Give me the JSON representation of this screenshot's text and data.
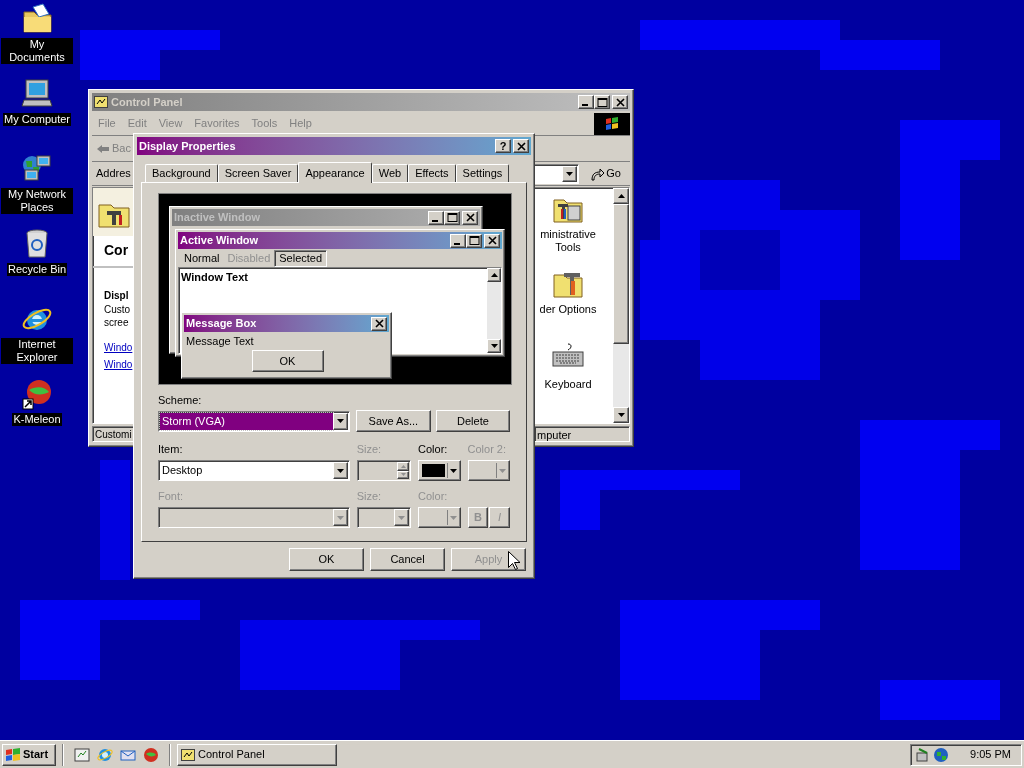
{
  "desktop_icons": [
    {
      "label": "My Documents",
      "kind": "documents"
    },
    {
      "label": "My Computer",
      "kind": "computer"
    },
    {
      "label": "My Network Places",
      "kind": "network"
    },
    {
      "label": "Recycle Bin",
      "kind": "recycle"
    },
    {
      "label": "Internet Explorer",
      "kind": "browser"
    },
    {
      "label": "K-Meleon",
      "kind": "kmeleon"
    }
  ],
  "control_panel": {
    "title": "Control Panel",
    "menu": [
      "File",
      "Edit",
      "View",
      "Favorites",
      "Tools",
      "Help"
    ],
    "back_button": "Bac",
    "address_label": "Addres",
    "go_button": "Go",
    "left_pane": {
      "heading": "Cor",
      "subheading": "Displ",
      "description": [
        "Custo",
        "scree"
      ],
      "links": [
        "Windo",
        "Windo"
      ]
    },
    "items": [
      {
        "label": "ministrative Tools",
        "kind": "admin"
      },
      {
        "label": "der Options",
        "kind": "folder_options"
      },
      {
        "label": "Keyboard",
        "kind": "keyboard"
      }
    ],
    "status": [
      "Customi",
      "mputer"
    ]
  },
  "dialog": {
    "title": "Display Properties",
    "help_button": "?",
    "tabs": [
      {
        "label": "Background",
        "selected": false
      },
      {
        "label": "Screen Saver",
        "selected": false
      },
      {
        "label": "Appearance",
        "selected": true
      },
      {
        "label": "Web",
        "selected": false
      },
      {
        "label": "Effects",
        "selected": false
      },
      {
        "label": "Settings",
        "selected": false
      }
    ],
    "preview": {
      "inactive_title": "Inactive Window",
      "active_title": "Active Window",
      "menu": [
        {
          "label": "Normal",
          "kind": "normal"
        },
        {
          "label": "Disabled",
          "kind": "disabled"
        },
        {
          "label": "Selected",
          "kind": "selected"
        }
      ],
      "window_text": "Window Text",
      "message_box": {
        "title": "Message Box",
        "text": "Message Text",
        "button": "OK"
      }
    },
    "scheme": {
      "label": "Scheme:",
      "value": "Storm (VGA)"
    },
    "scheme_buttons": [
      "Save As...",
      "Delete"
    ],
    "item_fields": [
      {
        "label": "Item:",
        "kind": "combo",
        "value": "Desktop",
        "disabled": false
      },
      {
        "label": "Size:",
        "kind": "spinner",
        "disabled": true
      },
      {
        "label": "Color:",
        "kind": "color",
        "color": "#000000",
        "disabled": false
      },
      {
        "label": "Color 2:",
        "kind": "color",
        "disabled": true
      }
    ],
    "font_fields": [
      {
        "label": "Font:",
        "kind": "combo",
        "disabled": true
      },
      {
        "label": "Size:",
        "kind": "combo",
        "disabled": true
      },
      {
        "label": "Color:",
        "kind": "color",
        "disabled": true
      },
      {
        "kind": "style",
        "buttons": [
          "B",
          "I"
        ],
        "disabled": true
      }
    ],
    "buttons": [
      {
        "label": "OK",
        "disabled": false
      },
      {
        "label": "Cancel",
        "disabled": false
      },
      {
        "label": "Apply",
        "disabled": true
      }
    ]
  },
  "taskbar": {
    "start": "Start",
    "quick_launch": [
      {
        "kind": "desktop"
      },
      {
        "kind": "browser"
      },
      {
        "kind": "mail"
      },
      {
        "kind": "kmeleon"
      }
    ],
    "tasks": [
      {
        "label": "Control Panel",
        "selected": false
      }
    ],
    "clock": "9:05 PM"
  }
}
